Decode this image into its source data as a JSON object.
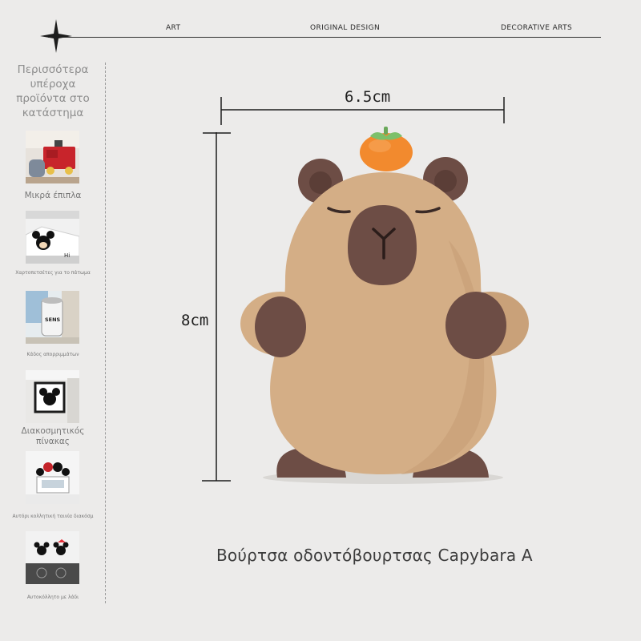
{
  "header": {
    "labels": [
      "ART",
      "ORIGINAL DESIGN",
      "DECORATIVE ARTS"
    ]
  },
  "sidebar": {
    "heading": "Περισσότερα υπέροχα προϊόντα στο κατάστημα",
    "items": [
      {
        "caption": "Μικρά έπιπλα",
        "thumb_icon": "red-furniture-photo"
      },
      {
        "caption": "Χαρτοπετσέτες για το πάτωμα",
        "thumb_icon": "mickey-mat-photo",
        "thumb_text": "Hi"
      },
      {
        "caption": "Κάδος απορριμμάτων",
        "thumb_icon": "trash-bin-photo",
        "thumb_text": "SENS"
      },
      {
        "caption": "Διακοσμητικός πίνακας",
        "thumb_icon": "wall-painting-photo"
      },
      {
        "caption": "Αυτόρι κολλητική ταινία διακόσμ",
        "thumb_icon": "mickey-hooks-photo"
      },
      {
        "caption": "Αυτοκόλλητο με λάδι",
        "thumb_icon": "kitchen-sticker-photo"
      }
    ]
  },
  "product": {
    "width_label": "6.5cm",
    "height_label": "8cm",
    "title": "Βούρτσα οδοντόβουρτσας Capybara A",
    "colors": {
      "body": "#d4ae86",
      "dark": "#6d4d45",
      "orange": "#f28a2e",
      "leaf": "#7cc06a"
    }
  }
}
